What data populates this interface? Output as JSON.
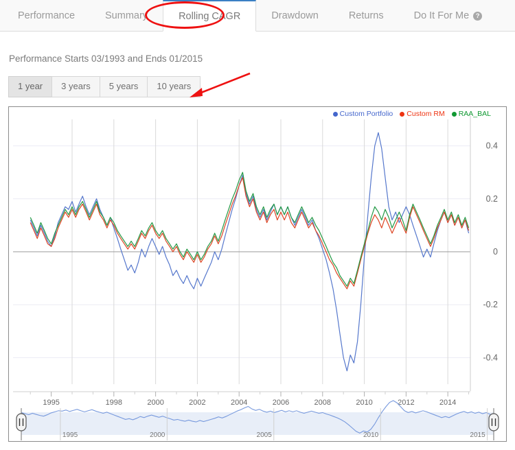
{
  "tabs": [
    {
      "label": "Performance",
      "active": false
    },
    {
      "label": "Summary",
      "active": false
    },
    {
      "label": "Rolling CAGR",
      "active": true
    },
    {
      "label": "Drawdown",
      "active": false
    },
    {
      "label": "Returns",
      "active": false
    },
    {
      "label": "Do It For Me",
      "active": false,
      "help_icon": "help-circle-icon",
      "help_glyph": "?"
    }
  ],
  "subtitle": "Performance Starts 03/1993 and Ends 01/2015",
  "period_buttons": [
    {
      "label": "1 year",
      "active": true
    },
    {
      "label": "3 years",
      "active": false
    },
    {
      "label": "5 years",
      "active": false
    },
    {
      "label": "10 years",
      "active": false
    }
  ],
  "annotations": {
    "ellipse_color": "#ee1111",
    "arrow_color": "#ee1111",
    "ellipse_target": "Rolling CAGR",
    "arrow_target": "10 years"
  },
  "colors": {
    "series_blue": "#5577cc",
    "series_red": "#dd4422",
    "series_green": "#229944",
    "legend_blue": "#4466cc",
    "legend_red": "#ee3311",
    "legend_green": "#119933",
    "gridline": "#d8d8d8",
    "zero_line": "#999999",
    "axis_text": "#666666",
    "navigator_line": "#7799dd",
    "navigator_fill": "#e8eef8",
    "active_tab_accent": "#3a7fc4"
  },
  "chart_data": {
    "type": "line",
    "title": "",
    "xlabel": "",
    "ylabel": "",
    "xlim": [
      1993.17,
      2015.08
    ],
    "ylim": [
      -0.5,
      0.5
    ],
    "grid": true,
    "legend_position": "top-right",
    "y_ticks": [
      0.4,
      0.2,
      0,
      -0.2,
      -0.4
    ],
    "y_tick_labels": [
      "0.4",
      "0.2",
      "0",
      "-0.2",
      "-0.4"
    ],
    "x_ticks": [
      1995,
      1998,
      2000,
      2002,
      2004,
      2006,
      2008,
      2010,
      2012,
      2014
    ],
    "x_tick_labels": [
      "1995",
      "1998",
      "2000",
      "2002",
      "2004",
      "2006",
      "2008",
      "2010",
      "2012",
      "2014"
    ],
    "x_gridlines": [
      1996,
      1998,
      2000,
      2002,
      2004,
      2006,
      2008,
      2010,
      2012,
      2014
    ],
    "series": [
      {
        "name": "Custom Portfolio",
        "color": "#5577cc",
        "x": [
          1994.0,
          1994.17,
          1994.33,
          1994.5,
          1994.67,
          1994.83,
          1995.0,
          1995.17,
          1995.33,
          1995.5,
          1995.67,
          1995.83,
          1996.0,
          1996.17,
          1996.33,
          1996.5,
          1996.67,
          1996.83,
          1997.0,
          1997.17,
          1997.33,
          1997.5,
          1997.67,
          1997.83,
          1998.0,
          1998.17,
          1998.33,
          1998.5,
          1998.67,
          1998.83,
          1999.0,
          1999.17,
          1999.33,
          1999.5,
          1999.67,
          1999.83,
          2000.0,
          2000.17,
          2000.33,
          2000.5,
          2000.67,
          2000.83,
          2001.0,
          2001.17,
          2001.33,
          2001.5,
          2001.67,
          2001.83,
          2002.0,
          2002.17,
          2002.33,
          2002.5,
          2002.67,
          2002.83,
          2003.0,
          2003.17,
          2003.33,
          2003.5,
          2003.67,
          2003.83,
          2004.0,
          2004.17,
          2004.33,
          2004.5,
          2004.67,
          2004.83,
          2005.0,
          2005.17,
          2005.33,
          2005.5,
          2005.67,
          2005.83,
          2006.0,
          2006.17,
          2006.33,
          2006.5,
          2006.67,
          2006.83,
          2007.0,
          2007.17,
          2007.33,
          2007.5,
          2007.67,
          2007.83,
          2008.0,
          2008.17,
          2008.33,
          2008.5,
          2008.67,
          2008.83,
          2009.0,
          2009.17,
          2009.33,
          2009.5,
          2009.67,
          2009.83,
          2010.0,
          2010.17,
          2010.33,
          2010.5,
          2010.67,
          2010.83,
          2011.0,
          2011.17,
          2011.33,
          2011.5,
          2011.67,
          2011.83,
          2012.0,
          2012.17,
          2012.33,
          2012.5,
          2012.67,
          2012.83,
          2013.0,
          2013.17,
          2013.33,
          2013.5,
          2013.67,
          2013.83,
          2014.0,
          2014.17,
          2014.33,
          2014.5,
          2014.67,
          2014.83,
          2015.0
        ],
        "y": [
          0.12,
          0.09,
          0.06,
          0.1,
          0.07,
          0.04,
          0.02,
          0.06,
          0.11,
          0.14,
          0.17,
          0.16,
          0.19,
          0.15,
          0.18,
          0.21,
          0.17,
          0.14,
          0.17,
          0.2,
          0.16,
          0.13,
          0.1,
          0.13,
          0.09,
          0.05,
          0.01,
          -0.03,
          -0.07,
          -0.05,
          -0.08,
          -0.04,
          0.01,
          -0.02,
          0.02,
          0.05,
          0.02,
          -0.01,
          0.02,
          -0.02,
          -0.05,
          -0.09,
          -0.07,
          -0.1,
          -0.12,
          -0.09,
          -0.12,
          -0.14,
          -0.1,
          -0.13,
          -0.1,
          -0.07,
          -0.04,
          0.0,
          -0.03,
          0.01,
          0.06,
          0.11,
          0.16,
          0.2,
          0.25,
          0.29,
          0.22,
          0.18,
          0.21,
          0.16,
          0.13,
          0.16,
          0.12,
          0.15,
          0.18,
          0.14,
          0.17,
          0.14,
          0.17,
          0.13,
          0.1,
          0.13,
          0.16,
          0.13,
          0.1,
          0.12,
          0.08,
          0.05,
          0.01,
          -0.03,
          -0.08,
          -0.14,
          -0.22,
          -0.31,
          -0.4,
          -0.45,
          -0.39,
          -0.42,
          -0.34,
          -0.2,
          -0.02,
          0.14,
          0.28,
          0.4,
          0.45,
          0.39,
          0.28,
          0.17,
          0.12,
          0.15,
          0.11,
          0.14,
          0.17,
          0.14,
          0.1,
          0.06,
          0.02,
          -0.02,
          0.01,
          -0.02,
          0.03,
          0.08,
          0.12,
          0.15,
          0.11,
          0.14,
          0.1,
          0.13,
          0.09,
          0.12,
          0.07,
          0.03
        ]
      },
      {
        "name": "Custom RM",
        "color": "#dd4422",
        "x": [
          1994.0,
          1994.17,
          1994.33,
          1994.5,
          1994.67,
          1994.83,
          1995.0,
          1995.17,
          1995.33,
          1995.5,
          1995.67,
          1995.83,
          1996.0,
          1996.17,
          1996.33,
          1996.5,
          1996.67,
          1996.83,
          1997.0,
          1997.17,
          1997.33,
          1997.5,
          1997.67,
          1997.83,
          1998.0,
          1998.17,
          1998.33,
          1998.5,
          1998.67,
          1998.83,
          1999.0,
          1999.17,
          1999.33,
          1999.5,
          1999.67,
          1999.83,
          2000.0,
          2000.17,
          2000.33,
          2000.5,
          2000.67,
          2000.83,
          2001.0,
          2001.17,
          2001.33,
          2001.5,
          2001.67,
          2001.83,
          2002.0,
          2002.17,
          2002.33,
          2002.5,
          2002.67,
          2002.83,
          2003.0,
          2003.17,
          2003.33,
          2003.5,
          2003.67,
          2003.83,
          2004.0,
          2004.17,
          2004.33,
          2004.5,
          2004.67,
          2004.83,
          2005.0,
          2005.17,
          2005.33,
          2005.5,
          2005.67,
          2005.83,
          2006.0,
          2006.17,
          2006.33,
          2006.5,
          2006.67,
          2006.83,
          2007.0,
          2007.17,
          2007.33,
          2007.5,
          2007.67,
          2007.83,
          2008.0,
          2008.17,
          2008.33,
          2008.5,
          2008.67,
          2008.83,
          2009.0,
          2009.17,
          2009.33,
          2009.5,
          2009.67,
          2009.83,
          2010.0,
          2010.17,
          2010.33,
          2010.5,
          2010.67,
          2010.83,
          2011.0,
          2011.17,
          2011.33,
          2011.5,
          2011.67,
          2011.83,
          2012.0,
          2012.17,
          2012.33,
          2012.5,
          2012.67,
          2012.83,
          2013.0,
          2013.17,
          2013.33,
          2013.5,
          2013.67,
          2013.83,
          2014.0,
          2014.17,
          2014.33,
          2014.5,
          2014.67,
          2014.83,
          2015.0
        ],
        "y": [
          0.11,
          0.08,
          0.05,
          0.09,
          0.06,
          0.03,
          0.02,
          0.05,
          0.09,
          0.12,
          0.15,
          0.13,
          0.16,
          0.13,
          0.16,
          0.18,
          0.15,
          0.12,
          0.15,
          0.18,
          0.14,
          0.12,
          0.09,
          0.12,
          0.1,
          0.07,
          0.05,
          0.03,
          0.01,
          0.03,
          0.01,
          0.04,
          0.07,
          0.05,
          0.08,
          0.1,
          0.07,
          0.05,
          0.07,
          0.04,
          0.02,
          0.0,
          0.02,
          -0.01,
          -0.03,
          0.0,
          -0.02,
          -0.04,
          -0.01,
          -0.04,
          -0.02,
          0.01,
          0.03,
          0.06,
          0.03,
          0.06,
          0.1,
          0.14,
          0.18,
          0.21,
          0.25,
          0.28,
          0.21,
          0.17,
          0.2,
          0.15,
          0.12,
          0.15,
          0.11,
          0.14,
          0.16,
          0.12,
          0.15,
          0.12,
          0.15,
          0.11,
          0.09,
          0.12,
          0.15,
          0.12,
          0.09,
          0.11,
          0.08,
          0.06,
          0.03,
          0.0,
          -0.03,
          -0.05,
          -0.08,
          -0.1,
          -0.12,
          -0.14,
          -0.11,
          -0.13,
          -0.08,
          -0.03,
          0.02,
          0.07,
          0.11,
          0.14,
          0.12,
          0.09,
          0.13,
          0.1,
          0.07,
          0.1,
          0.13,
          0.1,
          0.07,
          0.13,
          0.17,
          0.14,
          0.11,
          0.08,
          0.05,
          0.02,
          0.05,
          0.09,
          0.12,
          0.15,
          0.11,
          0.14,
          0.1,
          0.13,
          0.09,
          0.12,
          0.08,
          0.12
        ]
      },
      {
        "name": "RAA_BAL",
        "color": "#229944",
        "x": [
          1994.0,
          1994.17,
          1994.33,
          1994.5,
          1994.67,
          1994.83,
          1995.0,
          1995.17,
          1995.33,
          1995.5,
          1995.67,
          1995.83,
          1996.0,
          1996.17,
          1996.33,
          1996.5,
          1996.67,
          1996.83,
          1997.0,
          1997.17,
          1997.33,
          1997.5,
          1997.67,
          1997.83,
          1998.0,
          1998.17,
          1998.33,
          1998.5,
          1998.67,
          1998.83,
          1999.0,
          1999.17,
          1999.33,
          1999.5,
          1999.67,
          1999.83,
          2000.0,
          2000.17,
          2000.33,
          2000.5,
          2000.67,
          2000.83,
          2001.0,
          2001.17,
          2001.33,
          2001.5,
          2001.67,
          2001.83,
          2002.0,
          2002.17,
          2002.33,
          2002.5,
          2002.67,
          2002.83,
          2003.0,
          2003.17,
          2003.33,
          2003.5,
          2003.67,
          2003.83,
          2004.0,
          2004.17,
          2004.33,
          2004.5,
          2004.67,
          2004.83,
          2005.0,
          2005.17,
          2005.33,
          2005.5,
          2005.67,
          2005.83,
          2006.0,
          2006.17,
          2006.33,
          2006.5,
          2006.67,
          2006.83,
          2007.0,
          2007.17,
          2007.33,
          2007.5,
          2007.67,
          2007.83,
          2008.0,
          2008.17,
          2008.33,
          2008.5,
          2008.67,
          2008.83,
          2009.0,
          2009.17,
          2009.33,
          2009.5,
          2009.67,
          2009.83,
          2010.0,
          2010.17,
          2010.33,
          2010.5,
          2010.67,
          2010.83,
          2011.0,
          2011.17,
          2011.33,
          2011.5,
          2011.67,
          2011.83,
          2012.0,
          2012.17,
          2012.33,
          2012.5,
          2012.67,
          2012.83,
          2013.0,
          2013.17,
          2013.33,
          2013.5,
          2013.67,
          2013.83,
          2014.0,
          2014.17,
          2014.33,
          2014.5,
          2014.67,
          2014.83,
          2015.0
        ],
        "y": [
          0.13,
          0.1,
          0.07,
          0.11,
          0.08,
          0.05,
          0.03,
          0.07,
          0.1,
          0.13,
          0.16,
          0.14,
          0.17,
          0.14,
          0.17,
          0.19,
          0.16,
          0.13,
          0.16,
          0.19,
          0.15,
          0.13,
          0.1,
          0.13,
          0.11,
          0.08,
          0.06,
          0.04,
          0.02,
          0.04,
          0.02,
          0.05,
          0.08,
          0.06,
          0.09,
          0.11,
          0.08,
          0.06,
          0.08,
          0.05,
          0.03,
          0.01,
          0.03,
          0.0,
          -0.02,
          0.01,
          -0.01,
          -0.03,
          0.0,
          -0.03,
          -0.01,
          0.02,
          0.04,
          0.07,
          0.04,
          0.08,
          0.12,
          0.16,
          0.2,
          0.23,
          0.27,
          0.3,
          0.23,
          0.19,
          0.22,
          0.17,
          0.14,
          0.17,
          0.13,
          0.16,
          0.18,
          0.14,
          0.17,
          0.14,
          0.17,
          0.13,
          0.11,
          0.14,
          0.17,
          0.14,
          0.11,
          0.13,
          0.1,
          0.08,
          0.05,
          0.02,
          -0.01,
          -0.04,
          -0.06,
          -0.09,
          -0.11,
          -0.13,
          -0.1,
          -0.12,
          -0.07,
          -0.02,
          0.03,
          0.08,
          0.13,
          0.17,
          0.15,
          0.12,
          0.16,
          0.13,
          0.09,
          0.12,
          0.15,
          0.12,
          0.08,
          0.14,
          0.18,
          0.15,
          0.12,
          0.09,
          0.06,
          0.03,
          0.06,
          0.1,
          0.13,
          0.16,
          0.12,
          0.15,
          0.11,
          0.14,
          0.1,
          0.13,
          0.09,
          0.1
        ]
      }
    ],
    "navigator": {
      "x_tick_labels": [
        "1995",
        "2000",
        "2005",
        "2010",
        "2015"
      ],
      "x_ticks": [
        1995,
        2000,
        2005,
        2010,
        2015
      ],
      "series_name": "Custom Portfolio",
      "values": [
        0.12,
        0.09,
        0.06,
        0.1,
        0.07,
        0.04,
        0.02,
        0.06,
        0.11,
        0.14,
        0.17,
        0.16,
        0.19,
        0.15,
        0.18,
        0.21,
        0.17,
        0.14,
        0.17,
        0.2,
        0.16,
        0.13,
        0.1,
        0.13,
        0.09,
        0.05,
        0.01,
        -0.03,
        -0.07,
        -0.05,
        -0.08,
        -0.04,
        0.01,
        -0.02,
        0.02,
        0.05,
        0.02,
        -0.01,
        0.02,
        -0.02,
        -0.05,
        -0.09,
        -0.07,
        -0.1,
        -0.12,
        -0.09,
        -0.12,
        -0.14,
        -0.1,
        -0.13,
        -0.1,
        -0.07,
        -0.04,
        0.0,
        -0.03,
        0.01,
        0.06,
        0.11,
        0.16,
        0.2,
        0.25,
        0.29,
        0.22,
        0.18,
        0.21,
        0.16,
        0.13,
        0.16,
        0.12,
        0.15,
        0.18,
        0.14,
        0.17,
        0.14,
        0.17,
        0.13,
        0.1,
        0.13,
        0.16,
        0.13,
        0.1,
        0.12,
        0.08,
        0.05,
        0.01,
        -0.03,
        -0.08,
        -0.14,
        -0.22,
        -0.31,
        -0.4,
        -0.45,
        -0.39,
        -0.42,
        -0.34,
        -0.2,
        -0.02,
        0.14,
        0.28,
        0.4,
        0.45,
        0.39,
        0.28,
        0.17,
        0.12,
        0.15,
        0.11,
        0.14,
        0.17,
        0.14,
        0.1,
        0.06,
        0.02,
        -0.02,
        0.01,
        -0.02,
        0.03,
        0.08,
        0.12,
        0.15,
        0.11,
        0.14,
        0.1,
        0.13,
        0.09,
        0.12,
        0.07,
        0.03
      ],
      "left_handle": "range-handle-left",
      "right_handle": "range-handle-right"
    }
  }
}
